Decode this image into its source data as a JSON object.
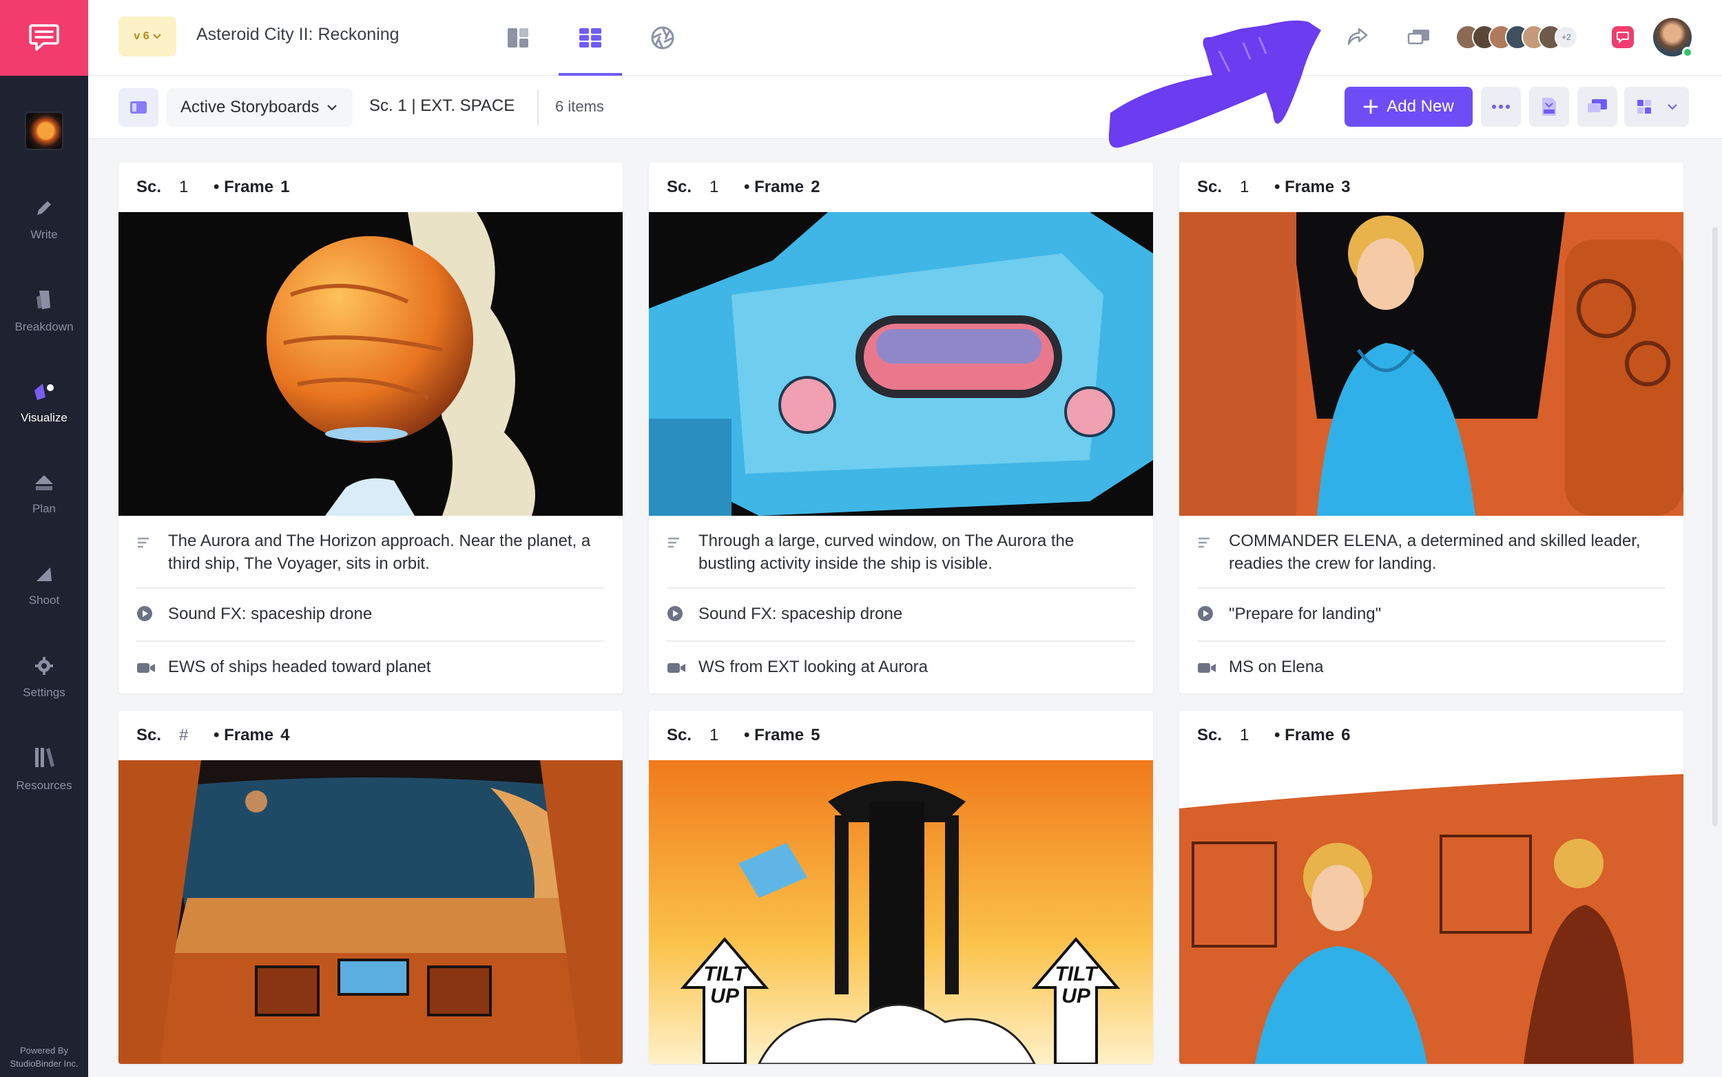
{
  "sidebar": {
    "items": [
      {
        "label": "Write",
        "icon": "pencil-icon"
      },
      {
        "label": "Breakdown",
        "icon": "tag-icon"
      },
      {
        "label": "Visualize",
        "icon": "visualize-icon",
        "active": true
      },
      {
        "label": "Plan",
        "icon": "plan-icon"
      },
      {
        "label": "Shoot",
        "icon": "shoot-icon"
      },
      {
        "label": "Settings",
        "icon": "gear-icon"
      },
      {
        "label": "Resources",
        "icon": "library-icon"
      }
    ],
    "powered_by_line1": "Powered By",
    "powered_by_line2": "StudioBinder Inc."
  },
  "topbar": {
    "version": "v 6",
    "project_title": "Asteroid City II: Reckoning",
    "collaborators_more": "+2"
  },
  "toolbar": {
    "board_select": "Active Storyboards",
    "scene": "Sc. 1  |  EXT. SPACE",
    "items_count": "6 items",
    "add_new": "Add New"
  },
  "colors": {
    "brand_pink": "#f23c6e",
    "accent_purple": "#6e4df7",
    "sidebar_bg": "#1f2230",
    "annotation_arrow": "#6b3cf0"
  },
  "cards": [
    {
      "sc_label": "Sc.",
      "sc_number": "1",
      "frame_label": "• Frame",
      "frame_number": "1",
      "description": "The Aurora and The Horizon approach. Near the planet, a third ship, The Voyager, sits in orbit.",
      "audio": "Sound FX: spaceship drone",
      "shot": "EWS of ships headed toward planet"
    },
    {
      "sc_label": "Sc.",
      "sc_number": "1",
      "frame_label": "• Frame",
      "frame_number": "2",
      "description": "Through a large, curved window, on The Aurora the bustling activity inside the ship is visible.",
      "audio": "Sound FX: spaceship drone",
      "shot": "WS from EXT looking at Aurora"
    },
    {
      "sc_label": "Sc.",
      "sc_number": "1",
      "frame_label": "• Frame",
      "frame_number": "3",
      "description": "COMMANDER ELENA, a determined and skilled leader, readies the crew for landing.",
      "audio": "\"Prepare for landing\"",
      "shot": "MS on Elena"
    },
    {
      "sc_label": "Sc.",
      "sc_number": "#",
      "frame_label": "• Frame",
      "frame_number": "4"
    },
    {
      "sc_label": "Sc.",
      "sc_number": "1",
      "frame_label": "• Frame",
      "frame_number": "5",
      "tilt_left": "TILT UP",
      "tilt_right": "TILT UP"
    },
    {
      "sc_label": "Sc.",
      "sc_number": "1",
      "frame_label": "• Frame",
      "frame_number": "6"
    }
  ]
}
